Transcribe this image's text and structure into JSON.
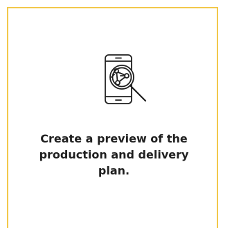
{
  "card": {
    "description": "Create a preview of the production and delivery plan.",
    "icon": "phone-magnifier-workflow-icon",
    "accent_color": "#f2c84b"
  }
}
